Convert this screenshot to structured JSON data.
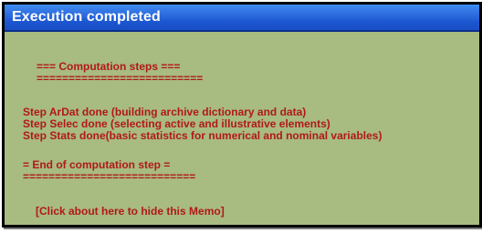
{
  "window": {
    "title": "Execution completed"
  },
  "memo": {
    "header": "=== Computation steps ===",
    "header_rule": "==========================",
    "steps": [
      "Step ArDat done (building archive dictionary and data)",
      "Step Selec done (selecting active and illustrative elements)",
      "Step Stats done(basic statistics for numerical and nominal variables)"
    ],
    "footer": "= End of computation step =",
    "footer_rule": "===========================",
    "hide_hint": "[Click about here to hide this Memo]"
  },
  "colors": {
    "title_bar": "#2f6fe0",
    "memo_background": "#a8bb80",
    "memo_text": "#b01919"
  }
}
